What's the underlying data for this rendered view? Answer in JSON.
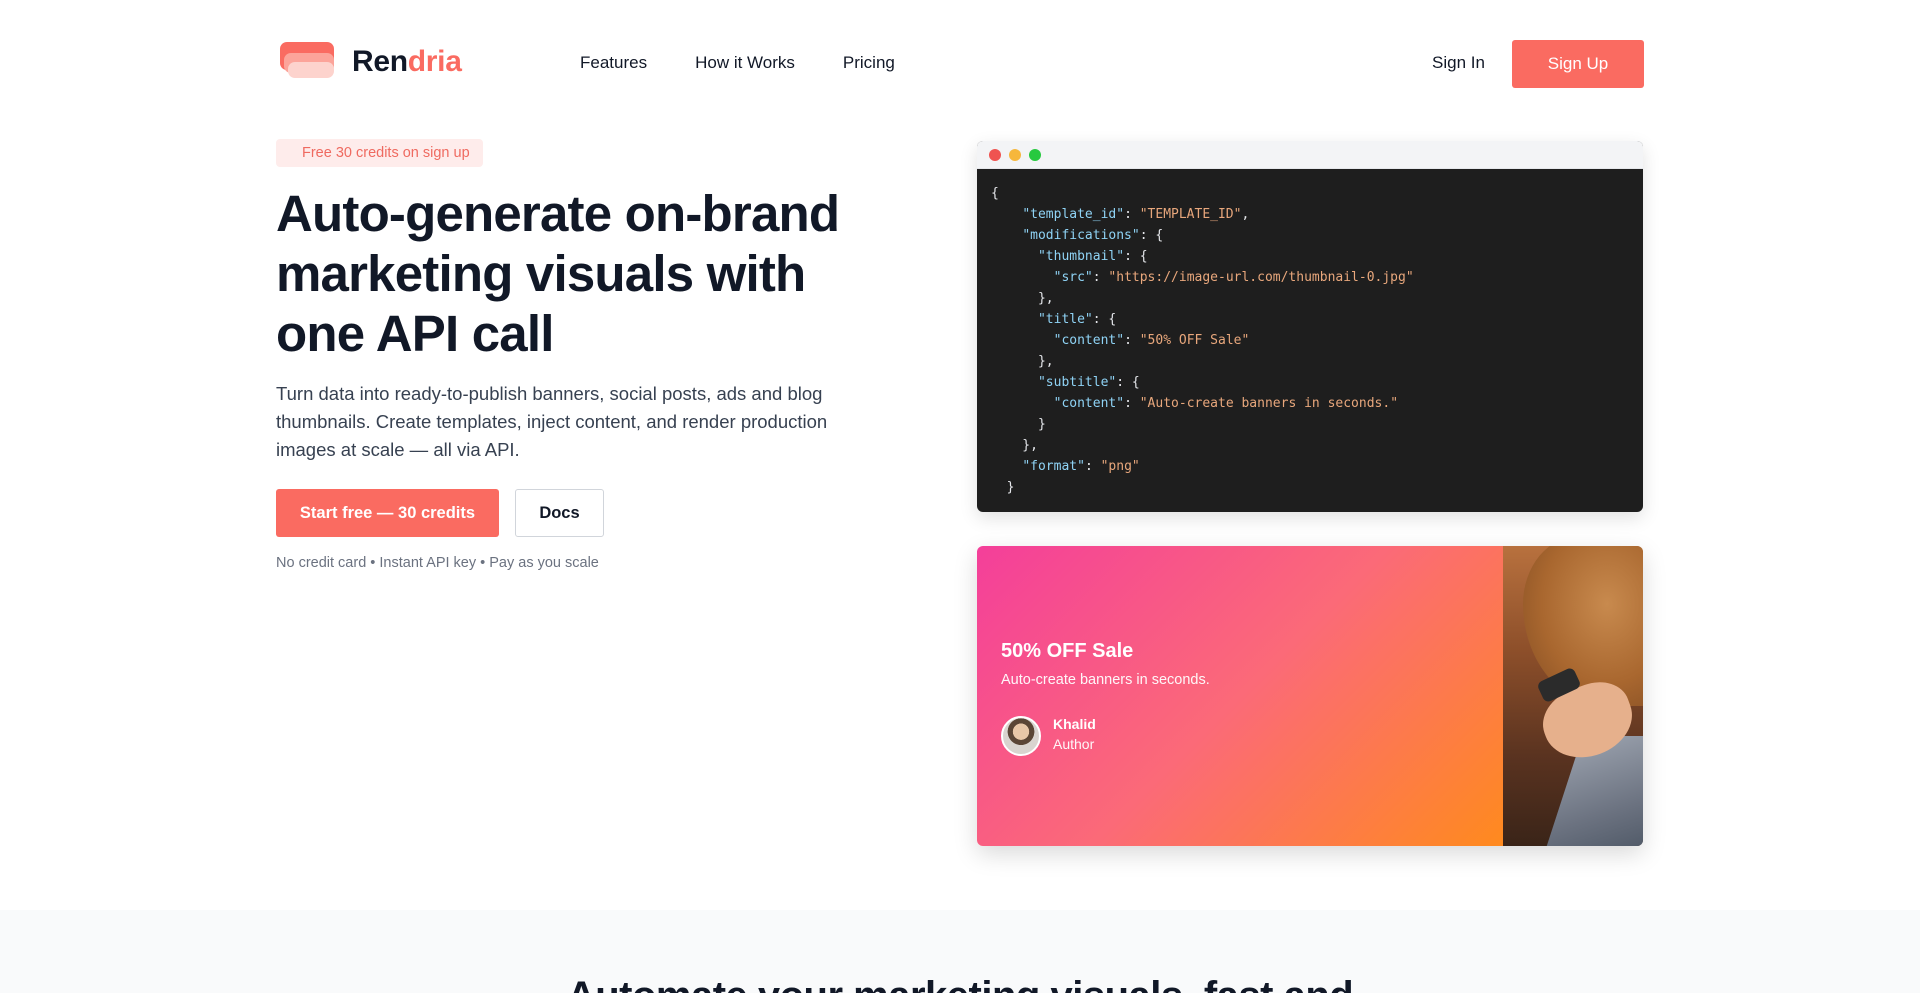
{
  "brand": {
    "name_part1": "Ren",
    "name_part2": "dria"
  },
  "nav": {
    "items": [
      {
        "label": "Features"
      },
      {
        "label": "How it Works"
      },
      {
        "label": "Pricing"
      }
    ],
    "sign_in": "Sign In",
    "sign_up": "Sign Up"
  },
  "hero": {
    "badge": "Free 30 credits on sign up",
    "title": "Auto-generate on-brand marketing visuals with one API call",
    "subtitle": "Turn data into ready-to-publish banners, social posts, ads and blog thumbnails. Create templates, inject content, and render production images at scale — all via API.",
    "cta_primary": "Start free — 30 credits",
    "cta_secondary": "Docs",
    "fineprint": "No credit card • Instant API key • Pay as you scale"
  },
  "code": {
    "k_template_id": "\"template_id\"",
    "v_template_id": "\"TEMPLATE_ID\"",
    "k_modifications": "\"modifications\"",
    "k_thumbnail": "\"thumbnail\"",
    "k_src": "\"src\"",
    "v_src": "\"https://image-url.com/thumbnail-0.jpg\"",
    "k_title": "\"title\"",
    "k_content1": "\"content\"",
    "v_content1": "\"50% OFF Sale\"",
    "k_subtitle": "\"subtitle\"",
    "k_content2": "\"content\"",
    "v_content2": "\"Auto-create banners in seconds.\"",
    "k_format": "\"format\"",
    "v_format": "\"png\""
  },
  "banner": {
    "title": "50% OFF Sale",
    "subtitle": "Auto-create banners in seconds.",
    "author_name": "Khalid",
    "author_role": "Author"
  },
  "section2": {
    "title": "Automate your marketing visuals, fast and"
  },
  "colors": {
    "accent": "#fa6b61",
    "text": "#111827",
    "muted": "#6b7280",
    "code_bg": "#1e1e1e"
  }
}
